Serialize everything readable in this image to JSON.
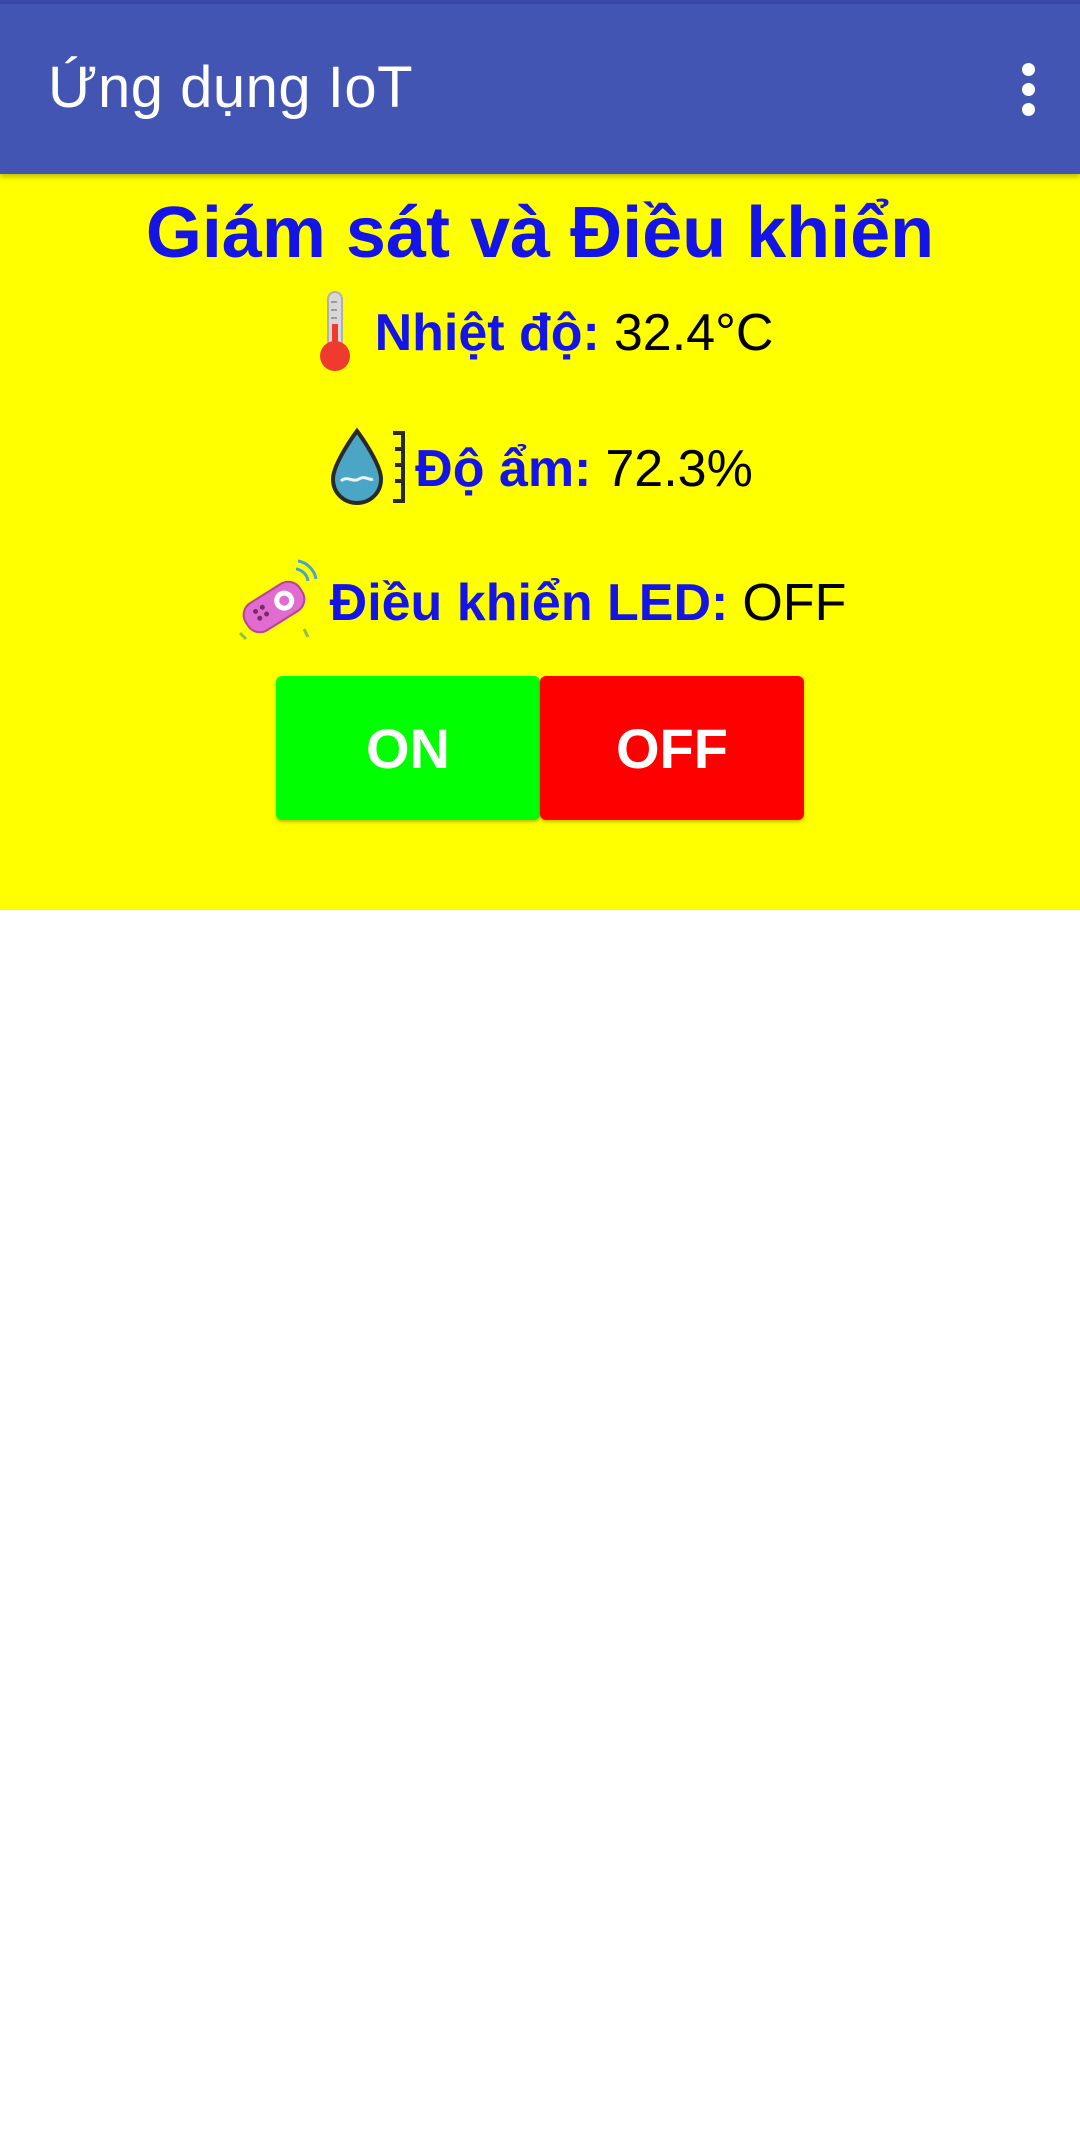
{
  "app": {
    "title": "Ứng dụng IoT",
    "menu_icon": "more-vert-icon"
  },
  "panel": {
    "heading": "Giám sát và Điều khiển",
    "background": "#ffff00",
    "text_color": "#1414e6"
  },
  "temperature": {
    "icon": "thermometer-icon",
    "label": "Nhiệt độ:",
    "value": "32.4°C"
  },
  "humidity": {
    "icon": "humidity-drop-icon",
    "label": "Độ ẩm:",
    "value": "72.3%"
  },
  "led": {
    "icon": "remote-control-icon",
    "label": "Điều khiển LED:",
    "value": "OFF"
  },
  "buttons": {
    "on_label": "ON",
    "on_color": "#00ff00",
    "off_label": "OFF",
    "off_color": "#ff0000"
  },
  "colors": {
    "appbar": "#4355b3",
    "statusbar": "#3a4aa5"
  }
}
